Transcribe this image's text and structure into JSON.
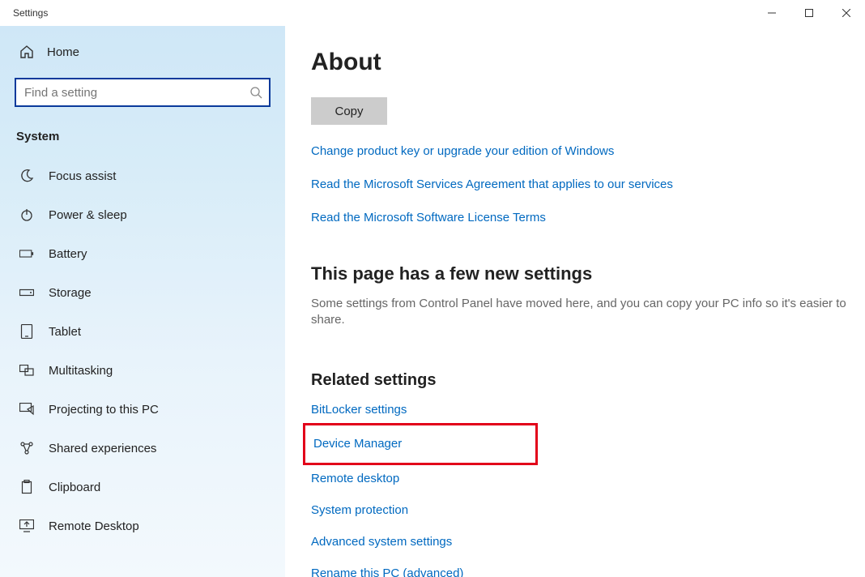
{
  "window": {
    "title": "Settings"
  },
  "sidebar": {
    "home": "Home",
    "search_placeholder": "Find a setting",
    "category": "System",
    "items": [
      {
        "label": "Focus assist"
      },
      {
        "label": "Power & sleep"
      },
      {
        "label": "Battery"
      },
      {
        "label": "Storage"
      },
      {
        "label": "Tablet"
      },
      {
        "label": "Multitasking"
      },
      {
        "label": "Projecting to this PC"
      },
      {
        "label": "Shared experiences"
      },
      {
        "label": "Clipboard"
      },
      {
        "label": "Remote Desktop"
      }
    ]
  },
  "main": {
    "title": "About",
    "copy_label": "Copy",
    "links": [
      "Change product key or upgrade your edition of Windows",
      "Read the Microsoft Services Agreement that applies to our services",
      "Read the Microsoft Software License Terms"
    ],
    "new_settings_heading": "This page has a few new settings",
    "new_settings_desc": "Some settings from Control Panel have moved here, and you can copy your PC info so it's easier to share.",
    "related_heading": "Related settings",
    "related": [
      "BitLocker settings",
      "Device Manager",
      "Remote desktop",
      "System protection",
      "Advanced system settings",
      "Rename this PC (advanced)"
    ],
    "highlighted_index": 1
  }
}
